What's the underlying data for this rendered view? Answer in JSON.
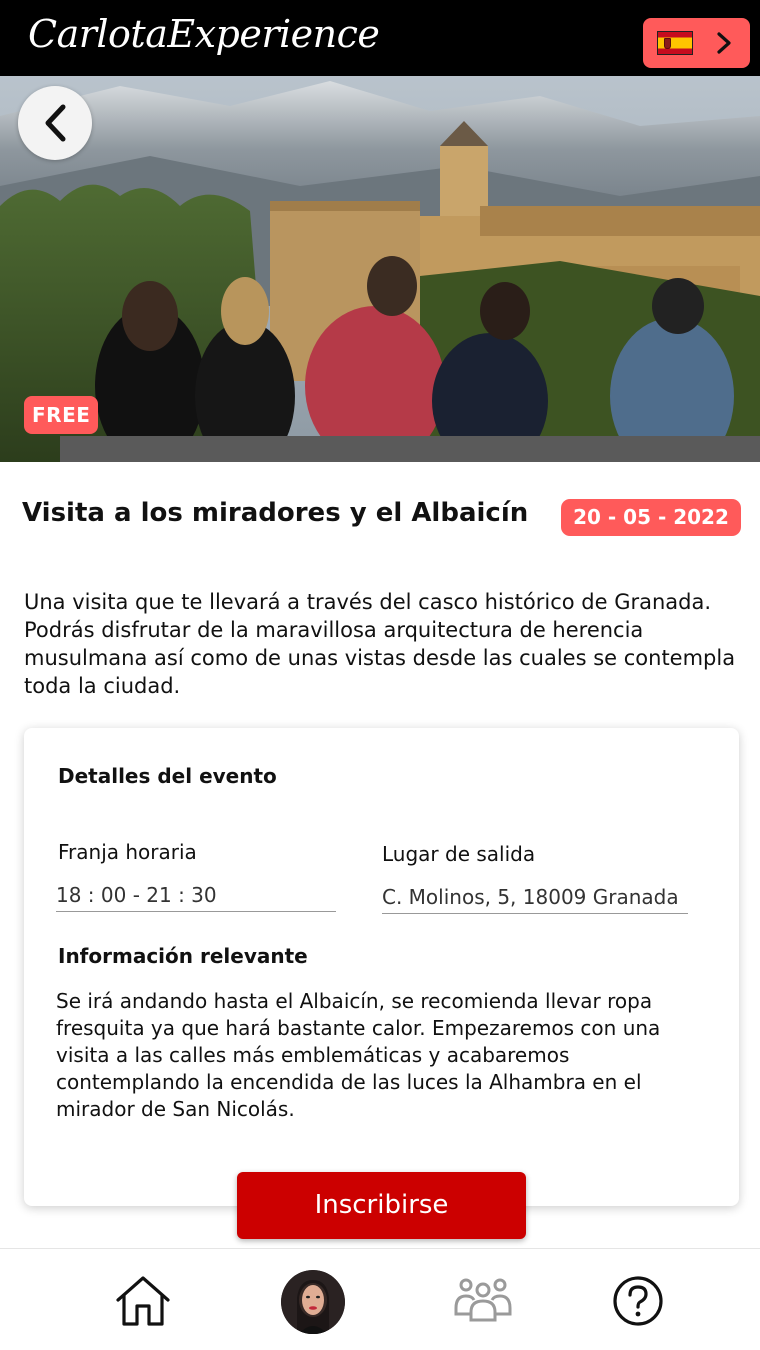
{
  "header": {
    "brand": "CarlotaExperience",
    "language_flag": "spain-flag-icon"
  },
  "hero": {
    "free_badge": "FREE"
  },
  "event": {
    "title": "Visita a los miradores y el Albaicín",
    "date": "20 - 05 - 2022",
    "description": "Una visita que te llevará a través del casco histórico de Granada. Podrás disfrutar de la maravillosa arquitectura de herencia musulmana así como de unas vistas desde las cuales se contempla toda la ciudad."
  },
  "details": {
    "title": "Detalles del evento",
    "time_label": "Franja horaria",
    "time_value": "18 : 00 - 21 : 30",
    "place_label": "Lugar de salida",
    "place_value": "C. Molinos, 5, 18009 Granada",
    "info_title": "Información relevante",
    "info_text": "Se irá andando hasta el Albaicín, se recomienda llevar ropa fresquita ya que hará bastante calor. Empezaremos con una visita a las calles más emblemáticas y acabaremos contemplando la encendida de las luces la Alhambra en el mirador de San Nicolás."
  },
  "actions": {
    "signup_label": "Inscribirse"
  },
  "nav": {
    "items": [
      "home-icon",
      "profile-avatar",
      "group-icon",
      "help-icon"
    ]
  },
  "colors": {
    "accent": "#ff5a5a",
    "primary_button": "#cc0000",
    "header_bg": "#000000"
  }
}
